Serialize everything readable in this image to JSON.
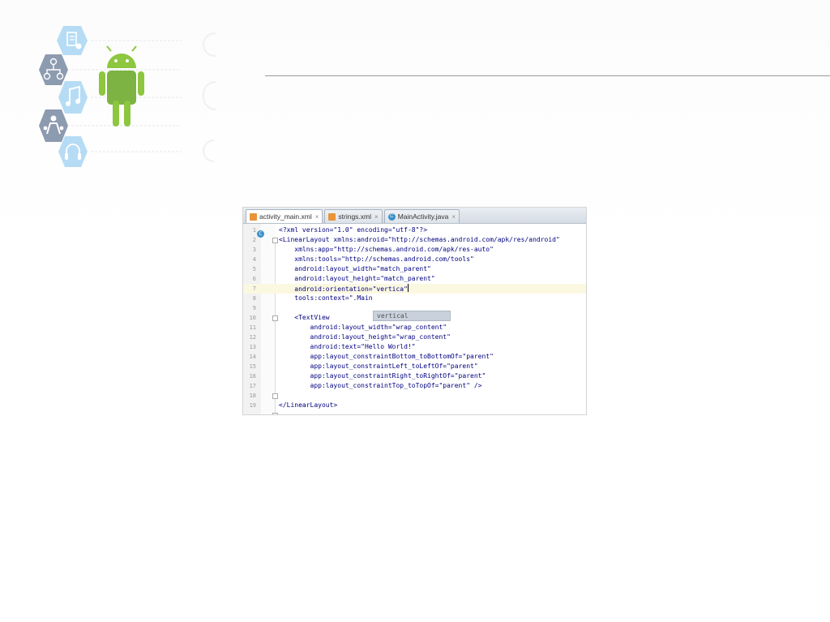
{
  "ide": {
    "tabs": [
      {
        "label": "activity_main.xml",
        "icon": "xml-file-icon",
        "active": true
      },
      {
        "label": "strings.xml",
        "icon": "xml-file-icon",
        "active": false
      },
      {
        "label": "MainActivity.java",
        "icon": "java-class-icon",
        "active": false
      }
    ],
    "tab_close": "×",
    "gutter_badge": "C",
    "lines": [
      {
        "n": "1",
        "text": "<?xml version=\"1.0\" encoding=\"utf-8\"?>"
      },
      {
        "n": "2",
        "text": "<LinearLayout xmlns:android=\"http://schemas.android.com/apk/res/android\""
      },
      {
        "n": "3",
        "text": "    xmlns:app=\"http://schemas.android.com/apk/res-auto\""
      },
      {
        "n": "4",
        "text": "    xmlns:tools=\"http://schemas.android.com/tools\""
      },
      {
        "n": "5",
        "text": "    android:layout_width=\"match_parent\""
      },
      {
        "n": "6",
        "text": "    android:layout_height=\"match_parent\""
      },
      {
        "n": "7",
        "text": "    android:orientation=\"vertica\"",
        "current": true
      },
      {
        "n": "8",
        "text": "    tools:context=\".Main"
      },
      {
        "n": "9",
        "text": ""
      },
      {
        "n": "10",
        "text": "    <TextView"
      },
      {
        "n": "11",
        "text": "        android:layout_width=\"wrap_content\""
      },
      {
        "n": "12",
        "text": "        android:layout_height=\"wrap_content\""
      },
      {
        "n": "13",
        "text": "        android:text=\"Hello World!\""
      },
      {
        "n": "14",
        "text": "        app:layout_constraintBottom_toBottomOf=\"parent\""
      },
      {
        "n": "15",
        "text": "        app:layout_constraintLeft_toLeftOf=\"parent\""
      },
      {
        "n": "16",
        "text": "        app:layout_constraintRight_toRightOf=\"parent\""
      },
      {
        "n": "17",
        "text": "        app:layout_constraintTop_toTopOf=\"parent\" />"
      },
      {
        "n": "18",
        "text": ""
      },
      {
        "n": "19",
        "text": "</LinearLayout>"
      }
    ],
    "autocomplete": "vertical"
  },
  "colors": {
    "android_green": "#8dc63f",
    "hex_blue": "#b6dcf5",
    "hex_grey": "#8d9bb0"
  }
}
